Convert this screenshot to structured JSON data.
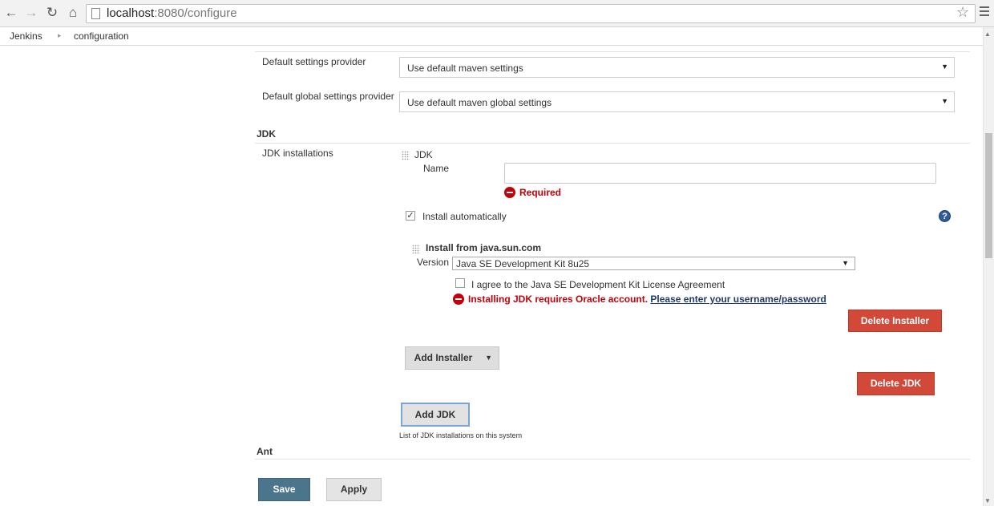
{
  "browser": {
    "url_host": "localhost",
    "url_path": ":8080/configure"
  },
  "breadcrumb": {
    "items": [
      "Jenkins",
      "configuration"
    ]
  },
  "maven": {
    "settings_label": "Default settings provider",
    "settings_value": "Use default maven settings",
    "global_label": "Default global settings provider",
    "global_value": "Use default maven global settings"
  },
  "jdk": {
    "section_title": "JDK",
    "installations_label": "JDK installations",
    "block_title": "JDK",
    "name_label": "Name",
    "name_value": "",
    "required_msg": "Required",
    "install_auto_label": "Install automatically",
    "install_auto_checked": true,
    "installer_title": "Install from java.sun.com",
    "version_label": "Version",
    "version_value": "Java SE Development Kit 8u25",
    "agree_label": "I agree to the Java SE Development Kit License Agreement",
    "agree_checked": false,
    "oracle_error": "Installing JDK requires Oracle account.",
    "oracle_link": "Please enter your username/password",
    "delete_installer": "Delete Installer",
    "add_installer": "Add Installer",
    "delete_jdk": "Delete JDK",
    "add_jdk": "Add JDK",
    "list_note": "List of JDK installations on this system"
  },
  "ant": {
    "section_title": "Ant"
  },
  "actions": {
    "save": "Save",
    "apply": "Apply"
  },
  "colors": {
    "danger": "#d24939",
    "error_text": "#c4000a",
    "primary": "#4b758b"
  }
}
